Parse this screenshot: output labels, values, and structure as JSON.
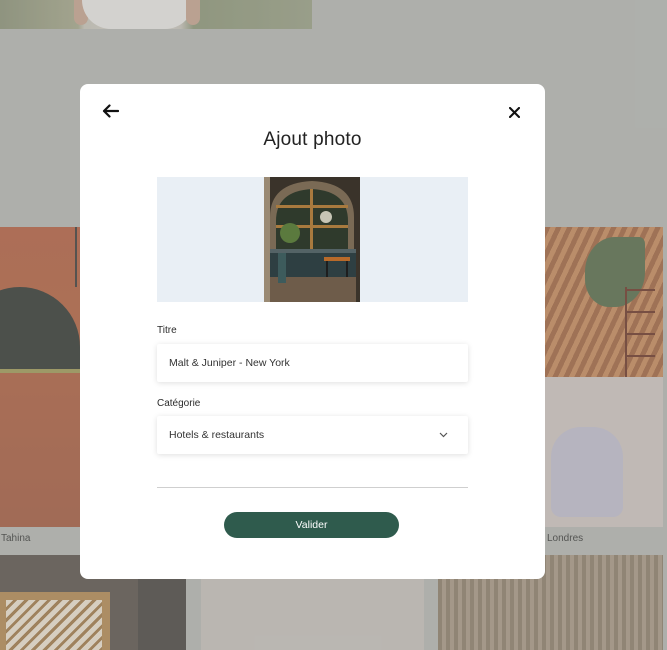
{
  "modal": {
    "title": "Ajout photo",
    "back_icon": "arrow-left-icon",
    "close_icon": "close-icon",
    "form": {
      "title_label": "Titre",
      "title_value": "Malt & Juniper - New York",
      "category_label": "Catégorie",
      "category_value": "Hotels & restaurants",
      "category_icon": "chevron-down-icon"
    },
    "submit_label": "Valider",
    "colors": {
      "accent": "#2f5b4d",
      "preview_bg": "#e9eff5"
    }
  },
  "gallery": {
    "captions": [
      "Tahina",
      "Londres"
    ]
  }
}
